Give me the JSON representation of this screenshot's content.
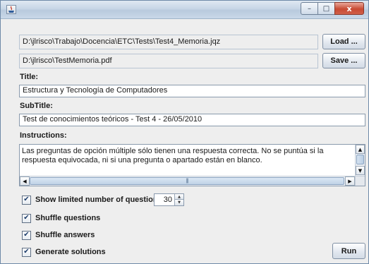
{
  "window": {
    "icon": "java-app-icon",
    "controls": {
      "minimize": "–",
      "maximize": "□",
      "close": "x"
    }
  },
  "files": {
    "input_path": "D:\\jlrisco\\Trabajo\\Docencia\\ETC\\Tests\\Test4_Memoria.jqz",
    "load_label": "Load ...",
    "output_path": "D:\\jlrisco\\TestMemoria.pdf",
    "save_label": "Save ..."
  },
  "title": {
    "label": "Title:",
    "value": "Estructura y Tecnología de Computadores"
  },
  "subtitle": {
    "label": "SubTitle:",
    "value": "Test de conocimientos teóricos - Test 4 - 26/05/2010"
  },
  "instructions": {
    "label": "Instructions:",
    "value": "Las preguntas de opción múltiple sólo tienen una respuesta correcta. No se puntúa si la respuesta equivocada, ni si una pregunta o apartado están en blanco.",
    "scroll_up": "▲",
    "scroll_down": "▼",
    "scroll_left": "◀",
    "scroll_right": "▶",
    "thumb_grip": "|||"
  },
  "options": {
    "check_mark": "✔",
    "limited": {
      "label": "Show limited number of questions",
      "checked": true
    },
    "question_count": "30",
    "spin_up": "▲",
    "spin_down": "▼",
    "shuffle_questions": {
      "label": "Shuffle questions",
      "checked": true
    },
    "shuffle_answers": {
      "label": "Shuffle answers",
      "checked": true
    },
    "generate_solutions": {
      "label": "Generate solutions",
      "checked": true
    }
  },
  "run_label": "Run"
}
